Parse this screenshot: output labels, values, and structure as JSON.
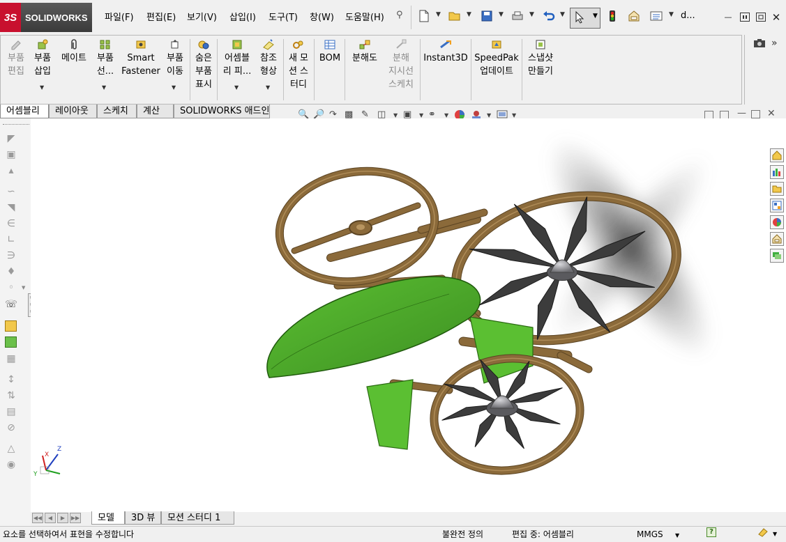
{
  "app": {
    "brand": "SOLIDWORKS",
    "brand_mark": "3S",
    "window_title_short": "d..."
  },
  "menu": [
    "파일(F)",
    "편집(E)",
    "보기(V)",
    "삽입(I)",
    "도구(T)",
    "창(W)",
    "도움말(H)"
  ],
  "commands": [
    {
      "id": "edit-component",
      "label": [
        "부품",
        "편집"
      ],
      "disabled": true
    },
    {
      "id": "insert-component",
      "label": [
        "부품",
        "삽입"
      ],
      "disabled": false
    },
    {
      "id": "mate",
      "label": [
        "메이트"
      ],
      "disabled": false
    },
    {
      "id": "component-pattern",
      "label": [
        "부품",
        "선..."
      ],
      "disabled": false
    },
    {
      "id": "smart-fasteners",
      "label": [
        "Smart",
        "Fastener"
      ],
      "disabled": false
    },
    {
      "id": "move-component",
      "label": [
        "부품",
        "이동"
      ],
      "disabled": false
    },
    {
      "id": "show-hidden",
      "label": [
        "숨은",
        "부품",
        "표시"
      ],
      "disabled": false
    },
    {
      "id": "assembly-features",
      "label": [
        "어셈블",
        "리 피..."
      ],
      "disabled": false
    },
    {
      "id": "reference-geometry",
      "label": [
        "참조",
        "형상"
      ],
      "disabled": false
    },
    {
      "id": "new-motion-study",
      "label": [
        "새 모",
        "션 스",
        "터디"
      ],
      "disabled": false
    },
    {
      "id": "bom",
      "label": [
        "BOM"
      ],
      "disabled": false
    },
    {
      "id": "exploded-view",
      "label": [
        "분해도"
      ],
      "disabled": false
    },
    {
      "id": "explode-line-sketch",
      "label": [
        "분해",
        "지시선",
        "스케치"
      ],
      "disabled": true
    },
    {
      "id": "instant3d",
      "label": [
        "Instant3D"
      ],
      "disabled": false
    },
    {
      "id": "speedpak",
      "label": [
        "SpeedPak",
        "업데이트"
      ],
      "disabled": false
    },
    {
      "id": "snapshot",
      "label": [
        "스냅샷",
        "만들기"
      ],
      "disabled": false
    }
  ],
  "tabs": [
    "어셈블리",
    "레이아웃",
    "스케치",
    "계산",
    "SOLIDWORKS 애드인"
  ],
  "active_tab": "어셈블리",
  "bottom_tabs": [
    "모델",
    "3D 뷰",
    "모션 스터디 1"
  ],
  "active_bottom_tab": "모델",
  "triad": {
    "x": "X",
    "y": "Y",
    "z": "Z"
  },
  "status": {
    "message": "요소를 선택하여서 표현을 수정합니다",
    "definition": "불완전 정의",
    "editing": "편집 중: 어셈블리",
    "units": "MMGS",
    "help": "?"
  },
  "colors": {
    "frame": "#8b6a3a",
    "frame_light": "#b89560",
    "canopy": "#3d8f22",
    "canopy_light": "#5bbf32",
    "blade": "#3c3c3c",
    "hub": "#8f8f95",
    "brand_red": "#c8102e"
  },
  "icons": {
    "new": "new-document-icon",
    "open": "open-folder-icon",
    "save": "save-icon",
    "print": "print-icon",
    "undo": "undo-icon",
    "select": "select-arrow-icon",
    "rebuild": "traffic-light-icon",
    "options": "options-icon"
  }
}
